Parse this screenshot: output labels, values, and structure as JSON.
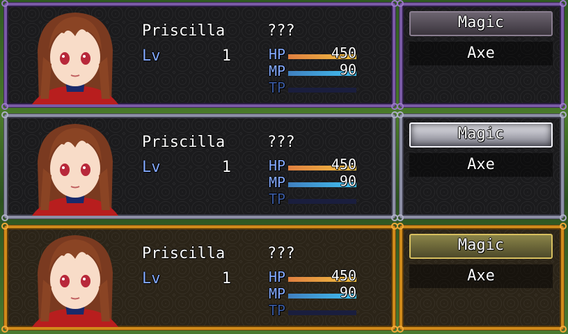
{
  "rows": [
    {
      "theme": "purple",
      "name": "Priscilla",
      "class": "???",
      "lv_label": "Lv",
      "lv": "1",
      "hp_label": "HP",
      "hp": "450",
      "hp_fill": 1.0,
      "mp_label": "MP",
      "mp": "90",
      "mp_fill": 1.0,
      "tp_label": "TP",
      "tp_fill": 0.0,
      "commands": [
        "Magic",
        "Axe"
      ],
      "selected": "Magic"
    },
    {
      "theme": "silver",
      "name": "Priscilla",
      "class": "???",
      "lv_label": "Lv",
      "lv": "1",
      "hp_label": "HP",
      "hp": "450",
      "hp_fill": 1.0,
      "mp_label": "MP",
      "mp": "90",
      "mp_fill": 1.0,
      "tp_label": "TP",
      "tp_fill": 0.0,
      "commands": [
        "Magic",
        "Axe"
      ],
      "selected": "Magic"
    },
    {
      "theme": "gold",
      "name": "Priscilla",
      "class": "???",
      "lv_label": "Lv",
      "lv": "1",
      "hp_label": "HP",
      "hp": "450",
      "hp_fill": 1.0,
      "mp_label": "MP",
      "mp": "90",
      "mp_fill": 1.0,
      "tp_label": "TP",
      "tp_fill": 0.0,
      "commands": [
        "Magic",
        "Axe"
      ],
      "selected": "Magic"
    }
  ],
  "colors": {
    "system_blue": "#84aaff",
    "hp_gauge": "#f0c040",
    "mp_gauge": "#40c0f0",
    "gauge_back": "#1a1e3e"
  }
}
